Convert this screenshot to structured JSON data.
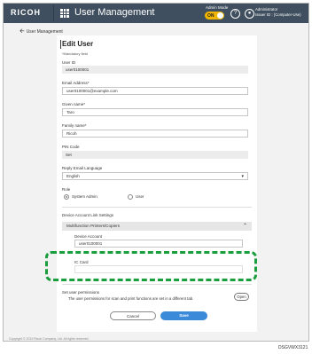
{
  "header": {
    "brand": "RICOH",
    "app_title": "User Management",
    "admin_mode_label": "Admin Mode",
    "admin_mode_toggle": "ON",
    "user_line1": "Administrator",
    "user_line2": "Issuer ID : (Computer-Use)"
  },
  "breadcrumb": {
    "label": "User Management"
  },
  "form": {
    "title": "Edit User",
    "mandatory_note": "*Mandatory field",
    "user_id_label": "User ID",
    "user_id_value": "user0100001",
    "email_label": "Email Address*",
    "email_value": "user0100001@example.com",
    "given_name_label": "Given name*",
    "given_name_value": "Taro",
    "family_name_label": "Family name*",
    "family_name_value": "Ricoh",
    "pin_label": "PIN Code",
    "pin_value": "Set",
    "language_label": "Reply Email Language",
    "language_value": "English",
    "role_label": "Role",
    "role_options": [
      "System Admin",
      "User"
    ],
    "role_selected": "System Admin",
    "device_link_label": "Device Account Link Settings",
    "accordion_label": "Multifunction Printers/Copiers",
    "device_account_label": "Device Account",
    "device_account_value": "user0100001",
    "ic_card_label": "IC Card",
    "ic_card_value": "",
    "set_permissions_label": "Set user permissions",
    "permissions_desc": "The user permissions for scan and print functions are set in a different tab.",
    "open_button": "Open",
    "cancel_button": "Cancel",
    "save_button": "Save"
  },
  "footer": {
    "copyright": "Copyright © 2019 Ricoh Company, Ltd. All rights reserved."
  },
  "figure_id": "DSGVWX3121",
  "colors": {
    "topbar": "#3f4f5f",
    "accent": "#f3b600",
    "primary": "#3a8ad9",
    "highlight": "#1a9e3d"
  }
}
